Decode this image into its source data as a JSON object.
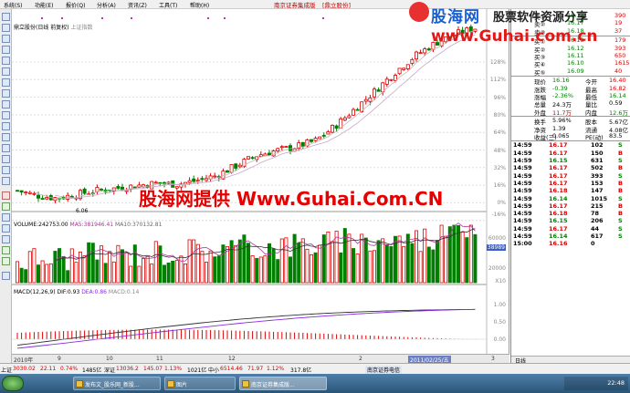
{
  "menu": {
    "items": [
      "系统(S)",
      "功能(E)",
      "报价(Q)",
      "分析(A)",
      "资讯(Z)",
      "工具(T)",
      "帮助(H)"
    ],
    "window_title_left": "南京证券集成版",
    "window_title_right": "[鼎立股份]"
  },
  "watermark": {
    "logo_cn": "股海网",
    "logo_slogan": "股票软件资源分享",
    "logo_url": "www.Guhai.com.cn",
    "center_text": "股海网提供 Www.Guhai.Com.CN"
  },
  "chart": {
    "header": "鼎立股份(日线 前复权)",
    "header_market": "上证指数",
    "pct_ticks": [
      "128%",
      "112%",
      "96%",
      "80%",
      "64%",
      "48%",
      "32%",
      "16%",
      "0%",
      "-16%"
    ],
    "low_label": "6.06",
    "volume_header": "VOLUME:242753.00",
    "ma5_label": "MA5:381946.41",
    "ma10_label": "MA10:370132.81",
    "vol_ticks": [
      "60000",
      "38989",
      "20000",
      "X10"
    ],
    "macd_header": "MACD(12,26,9)",
    "dif_label": "DIF:0.93",
    "dea_label": "DEA:0.86",
    "macd_label": "MACD:0.14",
    "macd_ticks": [
      "1.00",
      "0.50",
      "0.00"
    ],
    "date_labels": [
      "2010年",
      "9",
      "10",
      "11",
      "12",
      "2",
      "3"
    ],
    "selected_date": "2011/02/25/五",
    "colors": {
      "up": "#e00000",
      "down": "#008000",
      "dif": "#8a2be2",
      "dea": "#333333",
      "ma5": "#aa3399",
      "ma10": "#333333"
    }
  },
  "chart_data": {
    "type": "candlestick",
    "title": "",
    "price_trend_pct": [
      0,
      -4,
      -6,
      -3,
      0,
      2,
      4,
      6,
      5,
      8,
      12,
      20,
      28,
      32,
      35,
      40,
      52,
      66,
      80,
      95,
      108,
      118,
      125,
      130
    ],
    "volume_note": "daily volume bars with MA5 / MA10",
    "macd_note": "DIF, DEA lines with MACD histogram"
  },
  "quote": {
    "sell": [
      {
        "label": "卖③",
        "price": "16.18",
        "vol": "37"
      },
      {
        "label": "卖②",
        "price": "16.17",
        "vol": "19"
      },
      {
        "label": "卖①",
        "price": "16.14",
        "vol": "390"
      }
    ],
    "buy": [
      {
        "label": "买①",
        "price": "16.13",
        "vol": "179"
      },
      {
        "label": "买②",
        "price": "16.12",
        "vol": "393"
      },
      {
        "label": "买③",
        "price": "16.11",
        "vol": "650"
      },
      {
        "label": "买④",
        "price": "16.10",
        "vol": "1615"
      },
      {
        "label": "买⑤",
        "price": "16.09",
        "vol": "40"
      }
    ],
    "stats": [
      {
        "k1": "现价",
        "v1": "16.16",
        "k2": "今开",
        "v2": "16.40"
      },
      {
        "k1": "涨跌",
        "v1": "-0.39",
        "k2": "最高",
        "v2": "16.82"
      },
      {
        "k1": "涨幅",
        "v1": "-2.36%",
        "k2": "最低",
        "v2": "16.14"
      },
      {
        "k1": "总量",
        "v1": "24.3万",
        "k2": "量比",
        "v2": "0.59"
      },
      {
        "k1": "外盘",
        "v1": "11.7万",
        "k2": "内盘",
        "v2": "12.6万"
      }
    ],
    "stats2": [
      {
        "k1": "换手",
        "v1": "5.96%",
        "k2": "股本",
        "v2": "5.67亿"
      },
      {
        "k1": "净资",
        "v1": "1.39",
        "k2": "流通",
        "v2": "4.08亿"
      },
      {
        "k1": "收益(三)",
        "v1": "0.065",
        "k2": "PE(动)",
        "v2": "83.5"
      }
    ],
    "ticks": [
      {
        "t": "14:59",
        "p": "16.17",
        "v": "102",
        "s": "S"
      },
      {
        "t": "14:59",
        "p": "16.17",
        "v": "150",
        "s": "B"
      },
      {
        "t": "14:59",
        "p": "16.15",
        "v": "631",
        "s": "S"
      },
      {
        "t": "14:59",
        "p": "16.17",
        "v": "502",
        "s": "B"
      },
      {
        "t": "14:59",
        "p": "16.17",
        "v": "393",
        "s": "S"
      },
      {
        "t": "14:59",
        "p": "16.17",
        "v": "153",
        "s": "B"
      },
      {
        "t": "14:59",
        "p": "16.18",
        "v": "147",
        "s": "B"
      },
      {
        "t": "14:59",
        "p": "16.14",
        "v": "1015",
        "s": "S"
      },
      {
        "t": "14:59",
        "p": "16.17",
        "v": "215",
        "s": "B"
      },
      {
        "t": "14:59",
        "p": "16.18",
        "v": "78",
        "s": "B"
      },
      {
        "t": "14:59",
        "p": "16.15",
        "v": "206",
        "s": "S"
      },
      {
        "t": "14:59",
        "p": "16.17",
        "v": "44",
        "s": "S"
      },
      {
        "t": "14:59",
        "p": "16.14",
        "v": "617",
        "s": "S"
      },
      {
        "t": "15:00",
        "p": "16.16",
        "v": "0",
        "s": ""
      }
    ],
    "tabs": [
      "日线"
    ]
  },
  "status": {
    "sh_label": "上证",
    "sh_index": "3030.02",
    "sh_chg": "22.11",
    "sh_pct": "0.74%",
    "sh_amt": "1485亿",
    "sz_label": "深证",
    "sz_index": "13036.2",
    "sz_chg": "145.07",
    "sz_pct": "1.13%",
    "sz_amt": "1021亿",
    "zx_label": "中小",
    "zx_index": "6514.46",
    "zx_chg": "71.97",
    "zx_pct": "1.12%",
    "zx_amt": "317.8亿",
    "broker": "南京证券电信"
  },
  "taskbar": {
    "buttons": [
      "发布文_股乐网_新股...",
      "图片",
      "南京证券集成版..."
    ],
    "clock": "22:48"
  }
}
